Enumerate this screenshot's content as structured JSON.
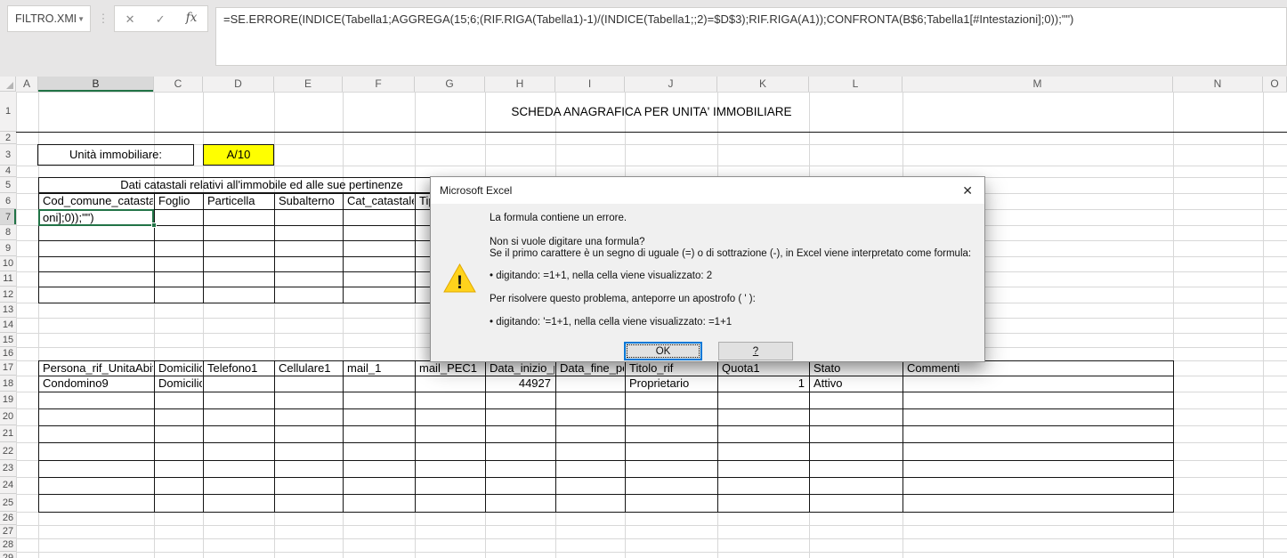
{
  "app": {
    "name_box": "FILTRO.XML",
    "formula": "=SE.ERRORE(INDICE(Tabella1;AGGREGA(15;6;(RIF.RIGA(Tabella1)-1)/(INDICE(Tabella1;;2)=$D$3);RIF.RIGA(A1));CONFRONTA(B$6;Tabella1[#Intestazioni];0));\"\")",
    "icons": {
      "dropdown": "▼",
      "dots": "⋮",
      "cancel": "✕",
      "enter": "✓",
      "fx": "fx"
    }
  },
  "grid": {
    "columns": [
      "A",
      "B",
      "C",
      "D",
      "E",
      "F",
      "G",
      "H",
      "I",
      "J",
      "K",
      "L",
      "M",
      "N",
      "O"
    ],
    "rows": [
      "1",
      "2",
      "3",
      "4",
      "5",
      "6",
      "7",
      "8",
      "9",
      "10",
      "11",
      "12",
      "13",
      "14",
      "15",
      "16",
      "17",
      "18",
      "19",
      "20",
      "21",
      "22",
      "23",
      "24",
      "25",
      "26",
      "27",
      "28",
      "29"
    ],
    "selected_column": "B",
    "selected_row": "7",
    "active_cell_text": "oni];0));\"\")"
  },
  "content": {
    "title": "SCHEDA ANAGRAFICA PER UNITA' IMMOBILIARE",
    "unit_label": "Unità immobiliare:",
    "unit_value": "A/10",
    "catasto": {
      "header": "Dati catastali relativi all'immobile ed alle sue pertinenze",
      "columns": [
        "Cod_comune_catastale",
        "Foglio",
        "Particella",
        "Subalterno",
        "Cat_catastale",
        "Tip"
      ]
    },
    "people": {
      "columns": [
        "Persona_rif_UnitaAbitativa",
        "Domicilio",
        "Telefono1",
        "Cellulare1",
        "mail_1",
        "mail_PEC1",
        "Data_inizio_p",
        "Data_fine_pe",
        "Titolo_rif",
        "Quota1",
        "Stato",
        "Commenti"
      ],
      "row": [
        "Condomino9",
        "Domicilio",
        "",
        "",
        "",
        "",
        "44927",
        "",
        "Proprietario",
        "1",
        "Attivo",
        ""
      ]
    }
  },
  "dialog": {
    "title": "Microsoft Excel",
    "close_icon": "✕",
    "warning_glyph": "!",
    "lines": [
      "La formula contiene un errore.",
      "Non si vuole digitare una formula?",
      "Se il primo carattere è un segno di uguale (=) o di sottrazione (-), in Excel viene interpretato come formula:",
      "• digitando: =1+1, nella cella viene visualizzato: 2",
      "Per risolvere questo problema, anteporre un apostrofo ( ' ):",
      "• digitando: '=1+1, nella cella viene visualizzato: =1+1"
    ],
    "ok_label": "OK",
    "help_label": "?"
  },
  "colors": {
    "excel_green": "#217346",
    "highlight_yellow": "#ffff00",
    "focus_blue": "#0078d7",
    "chrome_gray": "#e7e6e6"
  }
}
